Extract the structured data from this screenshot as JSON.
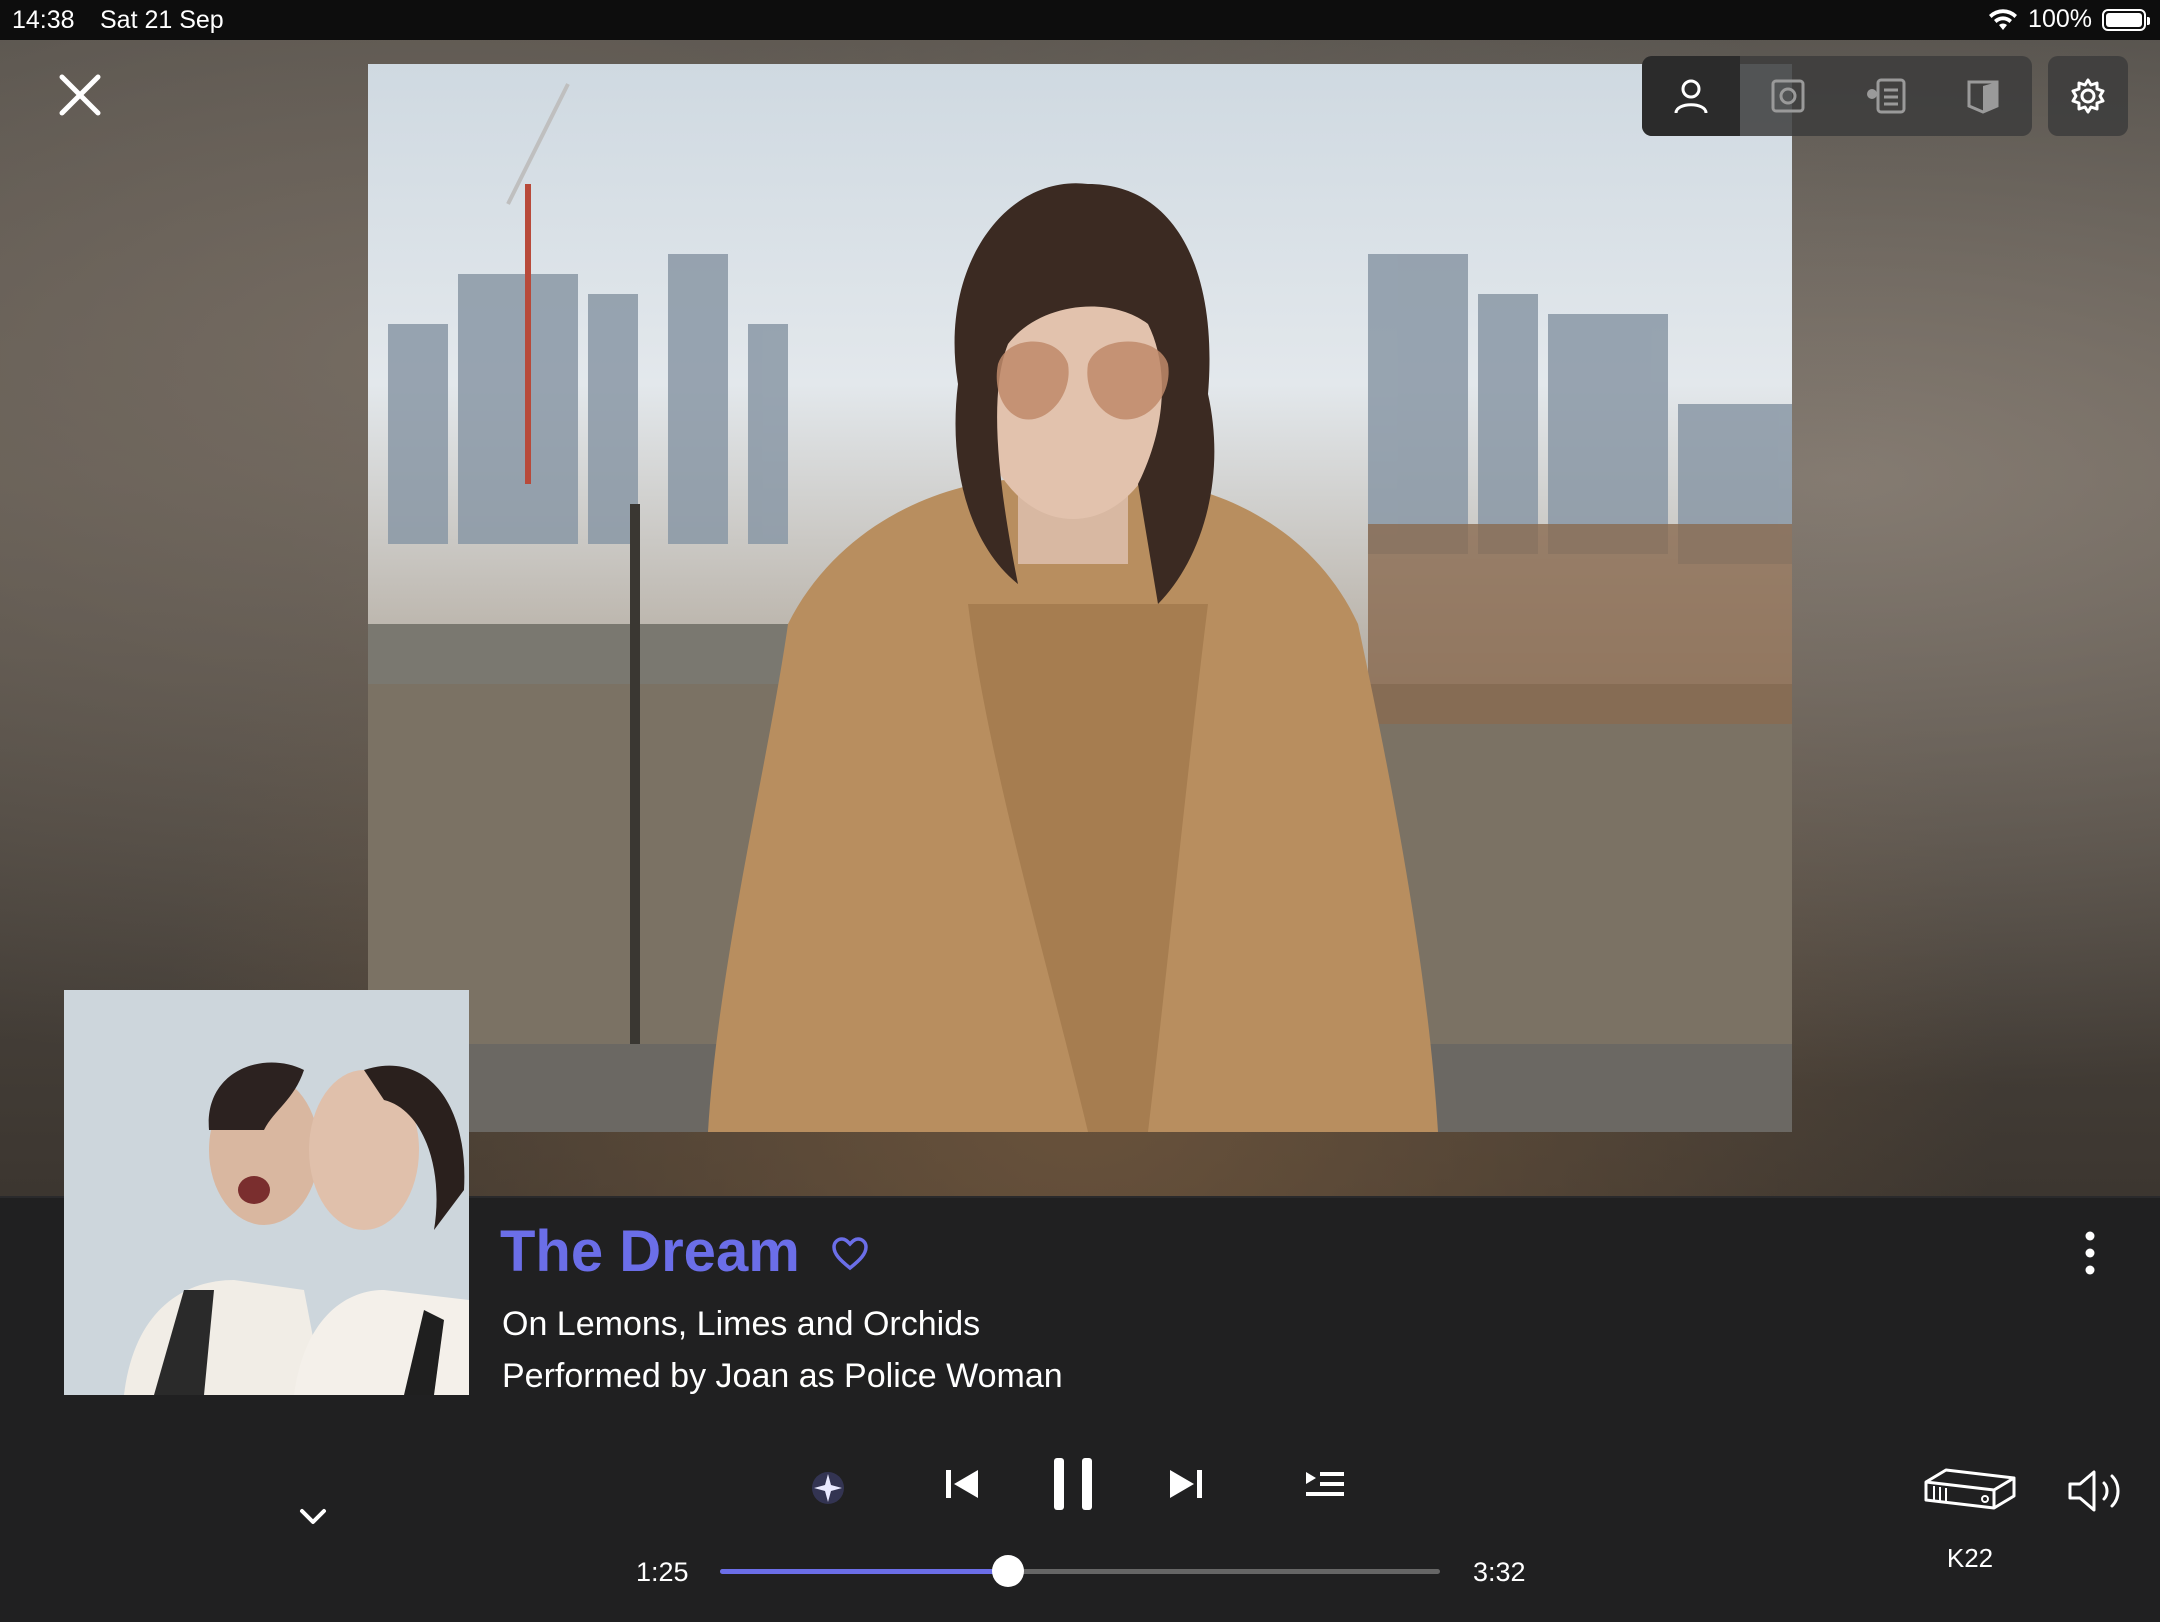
{
  "status_bar": {
    "time": "14:38",
    "date": "Sat 21 Sep",
    "battery": "100%"
  },
  "view_modes": [
    "artist",
    "album",
    "info",
    "booklet"
  ],
  "active_view": "artist",
  "track": {
    "title": "The Dream",
    "album": "On Lemons, Limes and Orchids",
    "performer": "Performed by Joan as Police Woman"
  },
  "playback": {
    "elapsed": "1:25",
    "total": "3:32",
    "progress": 0.4,
    "state": "playing"
  },
  "output": {
    "device": "K22"
  },
  "colors": {
    "accent": "#6b6ee8",
    "panel": "#202021"
  },
  "icons": {
    "close": "close-icon",
    "artist": "person-icon",
    "album": "album-icon",
    "info": "info-icon",
    "booklet": "booklet-icon",
    "settings": "gear-icon",
    "favorite": "heart-icon",
    "more": "more-vertical-icon",
    "collapse": "chevron-down-icon",
    "radio": "radio-sparkle-icon",
    "previous": "skip-previous-icon",
    "pause": "pause-icon",
    "next": "skip-next-icon",
    "queue": "queue-icon",
    "device": "streamer-device-icon",
    "volume": "volume-icon"
  }
}
